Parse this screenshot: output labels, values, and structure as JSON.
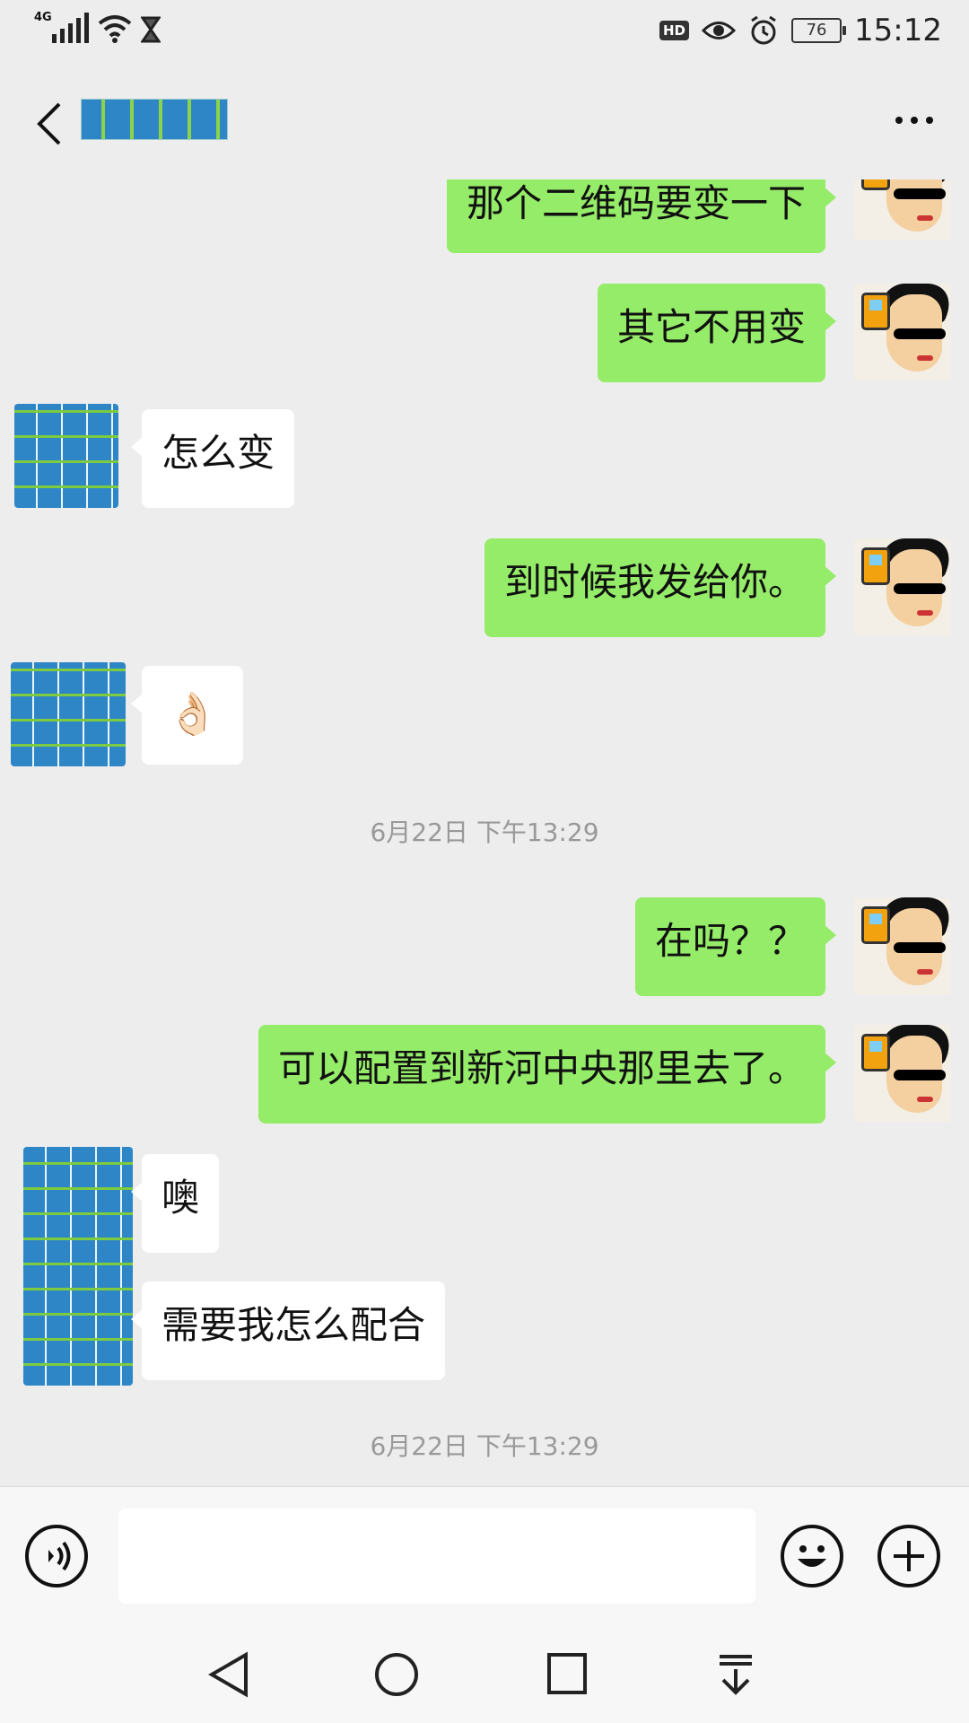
{
  "status_bar": {
    "network": "4G",
    "hd_badge": "HD",
    "battery": "76",
    "time": "15:12"
  },
  "header": {
    "back_icon": "chevron-left-icon",
    "more_icon": "more-horizontal-icon"
  },
  "messages": [
    {
      "side": "me",
      "text": "那个二维码要变一下"
    },
    {
      "side": "me",
      "text": "其它不用变"
    },
    {
      "side": "other",
      "text": "怎么变"
    },
    {
      "side": "me",
      "text": "到时候我发给你。"
    },
    {
      "side": "other",
      "text": "👌🏻"
    },
    {
      "side": "me",
      "text": "在吗？？"
    },
    {
      "side": "me",
      "text": "可以配置到新河中央那里去了。"
    },
    {
      "side": "other",
      "text": "噢"
    },
    {
      "side": "other",
      "text": "需要我怎么配合"
    }
  ],
  "timestamps": [
    "6月22日 下午13:29",
    "6月22日 下午13:29"
  ],
  "input_bar": {
    "placeholder": "",
    "voice_icon": "voice-icon",
    "emoji_icon": "emoji-icon",
    "plus_icon": "plus-icon"
  },
  "nav_bar": {
    "icons": [
      "back-triangle-icon",
      "home-circle-icon",
      "recents-square-icon",
      "notification-pulldown-icon"
    ]
  },
  "colors": {
    "background": "#ededed",
    "my_bubble": "#95ec69",
    "other_bubble": "#ffffff",
    "timestamp_text": "#999999"
  }
}
